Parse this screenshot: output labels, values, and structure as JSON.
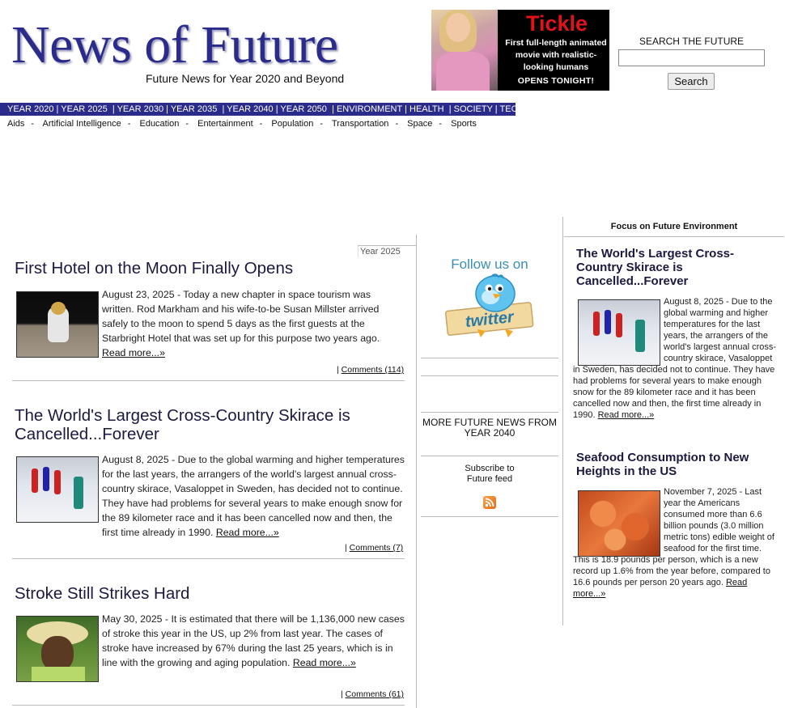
{
  "header": {
    "logo": "News of Future",
    "tagline": "Future News for Year 2020 and Beyond"
  },
  "ad": {
    "title": "Tickle",
    "subtitle": "First full-length animated movie with realistic-looking humans",
    "cta": "OPENS TONIGHT!"
  },
  "search": {
    "label": "SEARCH THE FUTURE",
    "value": "",
    "button": "Search"
  },
  "nav": {
    "items": [
      "YEAR 2020",
      "YEAR 2025",
      "YEAR 2030",
      "YEAR 2035",
      "YEAR 2040",
      "YEAR 2050",
      "ENVIRONMENT",
      "HEALTH",
      "SOCIETY",
      "TECHNOLOGY"
    ]
  },
  "subnav": {
    "items": [
      "Aids",
      "Artificial Intelligence",
      "Education",
      "Entertainment",
      "Population",
      "Transportation",
      "Space",
      "Sports"
    ]
  },
  "main": {
    "year_tag": "Year 2025",
    "articles": [
      {
        "title": "First Hotel on the Moon Finally Opens",
        "text": "August 23, 2025 - Today a new chapter in space tourism was written. Rod Markham and his wife-to-be Susan Millster arrived safely to the moon to spend 5 days as the first guests at the Starbright Hotel that was set up for this purpose two years ago.",
        "read_more": "Read more...»",
        "comments": "Comments (114)"
      },
      {
        "title": "The World's Largest Cross-Country Skirace is Cancelled...Forever",
        "text": "August 8, 2025 - Due to the global warming and higher temperatures for the last years, the arrangers of the world's largest annual cross-country skirace, Vasaloppet in Sweden, has decided not to continue. They have had problems for several years to make enough snow for the 89 kilometer race and it has been cancelled now and then, the first time already in 1990.",
        "read_more": "Read more...»",
        "comments": "Comments (7)"
      },
      {
        "title": "Stroke Still Strikes Hard",
        "text": "May 30, 2025 - It is estimated that there will be 1,136,000 new cases of stroke this year in the US, up 2% from last year. The cases of stroke have increased by 67% during the last 25 years, which is in line with the growing and aging population.",
        "read_more": "Read more...»",
        "comments": "Comments (61)"
      }
    ]
  },
  "middle": {
    "follow_title": "Follow us on",
    "twitter_label": "twitter",
    "more_news": "MORE FUTURE NEWS FROM YEAR 2040",
    "subscribe_line1": "Subscribe to",
    "subscribe_line2": "Future feed"
  },
  "right": {
    "focus_title": "Focus on Future Environment",
    "articles": [
      {
        "title": "The World's Largest Cross-Country Skirace is Cancelled...Forever",
        "text": "August 8, 2025 - Due to the global warming and higher temperatures for the last years, the arrangers of the world's largest annual cross-country skirace, Vasaloppet in Sweden, has decided not to continue. They have had problems for several years to make enough snow for the 89 kilometer race and it has been cancelled now and then, the first time already in 1990.",
        "read_more": "Read more...»"
      },
      {
        "title": "Seafood Consumption to New Heights in the US",
        "text": "November 7, 2025 - Last year the Americans consumed more than 6.6 billion pounds (3.0 million metric tons) edible weight of seafood for the first time. This is 18.9 pounds per person, which is a new record up 1.6% from the year before, compared to 16.6 pounds per person 20 years ago.",
        "read_more": "Read more...»"
      }
    ]
  },
  "colors": {
    "brand": "#2b2b8c",
    "nav_bg": "#2b2b8c",
    "twitter_blue": "#3a8fb0",
    "rss_orange": "#e46b15"
  }
}
